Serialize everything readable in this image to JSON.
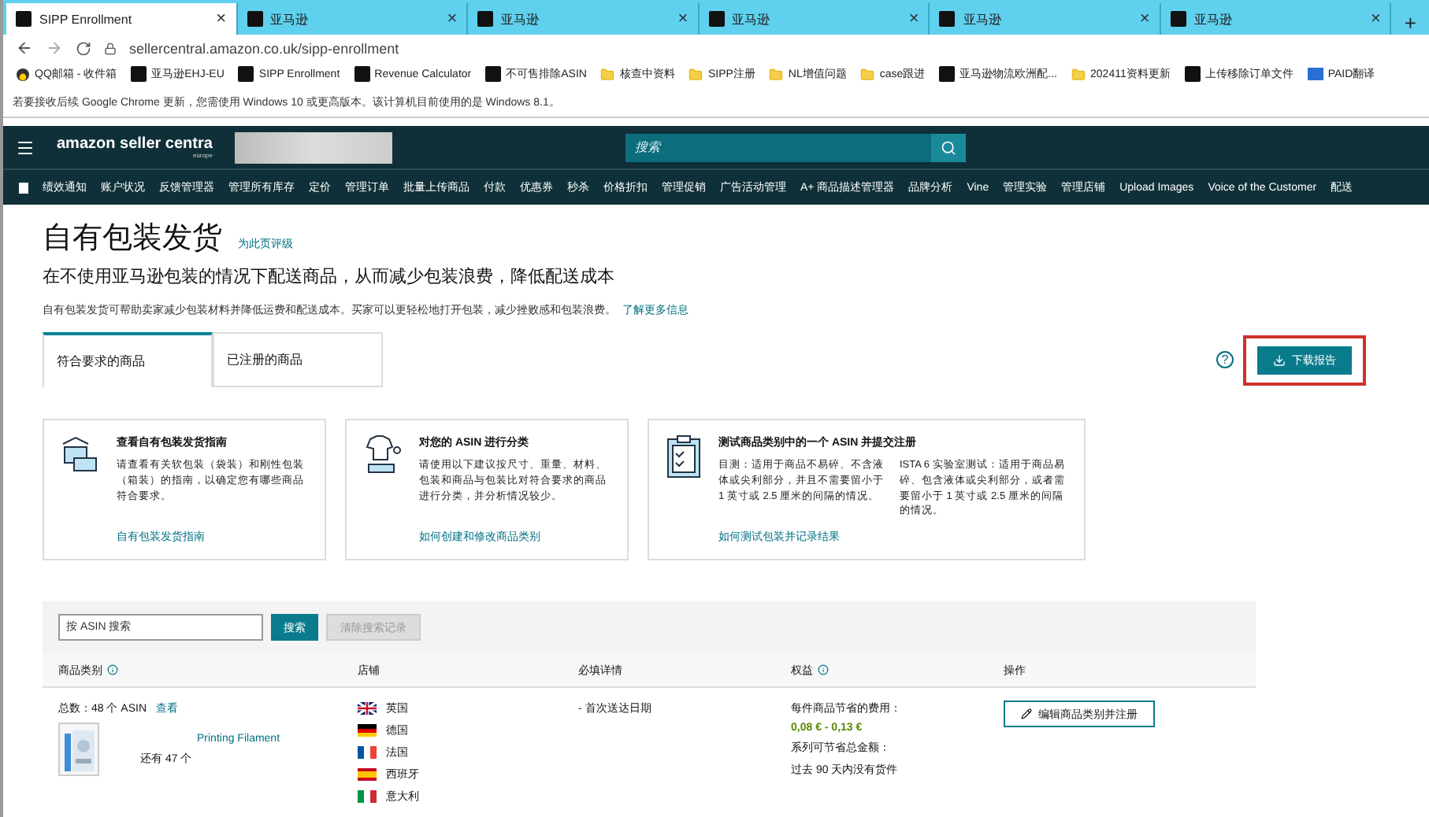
{
  "browser": {
    "tabs": [
      {
        "title": "SIPP Enrollment",
        "selected": true
      },
      {
        "title": "亚马逊",
        "selected": false
      },
      {
        "title": "亚马逊",
        "selected": false
      },
      {
        "title": "亚马逊",
        "selected": false
      },
      {
        "title": "亚马逊",
        "selected": false
      },
      {
        "title": "亚马逊",
        "selected": false
      }
    ],
    "new_tab": "+",
    "tab_close": "×",
    "url": "sellercentral.amazon.co.uk/sipp-enrollment",
    "bookmarks": [
      {
        "label": "QQ邮箱 - 收件箱",
        "kind": "qq"
      },
      {
        "label": "亚马逊EHJ-EU",
        "kind": "site"
      },
      {
        "label": "SIPP Enrollment",
        "kind": "site"
      },
      {
        "label": "Revenue Calculator",
        "kind": "site"
      },
      {
        "label": "不可售排除ASIN",
        "kind": "site"
      },
      {
        "label": "核查中资料",
        "kind": "folder"
      },
      {
        "label": "SIPP注册",
        "kind": "folder"
      },
      {
        "label": "NL增值问题",
        "kind": "folder"
      },
      {
        "label": "case跟进",
        "kind": "folder"
      },
      {
        "label": "亚马逊物流欧洲配...",
        "kind": "site"
      },
      {
        "label": "202411资料更新",
        "kind": "folder"
      },
      {
        "label": "上传移除订单文件",
        "kind": "site"
      },
      {
        "label": "PAID翻译",
        "kind": "xm"
      }
    ],
    "notice": "若要接收后续 Google Chrome 更新，您需使用 Windows 10 或更高版本。该计算机目前使用的是 Windows 8.1。"
  },
  "header": {
    "logo": "amazon seller centra",
    "logo_region": "europe",
    "search_placeholder": "搜索"
  },
  "nav": [
    "绩效通知",
    "账户状况",
    "反馈管理器",
    "管理所有库存",
    "定价",
    "管理订单",
    "批量上传商品",
    "付款",
    "优惠券",
    "秒杀",
    "价格折扣",
    "管理促销",
    "广告活动管理",
    "A+ 商品描述管理器",
    "品牌分析",
    "Vine",
    "管理实验",
    "管理店铺",
    "Upload Images",
    "Voice of the Customer",
    "配送"
  ],
  "page": {
    "title": "自有包装发货",
    "rate_link": "为此页评级",
    "subtitle": "在不使用亚马逊包装的情况下配送商品，从而减少包装浪费，降低配送成本",
    "description": "自有包装发货可帮助卖家减少包装材料并降低运费和配送成本。买家可以更轻松地打开包装，减少挫败感和包装浪费。",
    "learn_more": "了解更多信息",
    "tabs": [
      {
        "label": "符合要求的商品",
        "selected": true
      },
      {
        "label": "已注册的商品",
        "selected": false
      }
    ],
    "help": "?",
    "download_button": "下载报告"
  },
  "cards": [
    {
      "kind": "boxes",
      "title": "查看自有包装发货指南",
      "texts": [
        "请查看有关软包装（袋装）和刚性包装（箱装）的指南，以确定您有哪些商品符合要求。"
      ],
      "link": "自有包装发货指南"
    },
    {
      "kind": "shirt",
      "title": "对您的 ASIN 进行分类",
      "texts": [
        "请使用以下建议按尺寸、重量、材料、包装和商品与包装比对符合要求的商品进行分类，并分析情况较少。"
      ],
      "link": "如何创建和修改商品类别"
    },
    {
      "kind": "clipboard",
      "title": "测试商品类别中的一个 ASIN 并提交注册",
      "texts": [
        "目测：适用于商品不易碎、不含液体或尖利部分，并且不需要留小于 1 英寸或 2.5 厘米的间隔的情况。",
        "ISTA 6 实验室测试：适用于商品易碎、包含液体或尖利部分，或者需要留小于 1 英寸或 2.5 厘米的间隔的情况。"
      ],
      "link": "如何测试包装并记录结果"
    }
  ],
  "search": {
    "placeholder": "按 ASIN 搜索",
    "button": "搜索",
    "clear_button": "清除搜索记录",
    "clear_disabled": true
  },
  "table": {
    "columns": [
      {
        "label": "商品类别",
        "info": true
      },
      {
        "label": "店铺",
        "info": false
      },
      {
        "label": "必填详情",
        "info": false
      },
      {
        "label": "权益",
        "info": true
      },
      {
        "label": "操作",
        "info": false
      }
    ],
    "rows": [
      {
        "total": "总数：48 个 ASIN",
        "view_link": "查看",
        "product": "Printing Filament",
        "more": "还有 47 个",
        "stores": [
          {
            "name": "英国",
            "kind": "uk"
          },
          {
            "name": "德国",
            "kind": "de"
          },
          {
            "name": "法国",
            "kind": "fr"
          },
          {
            "name": "西班牙",
            "kind": "es"
          },
          {
            "name": "意大利",
            "kind": "it"
          }
        ],
        "details": "- 首次送达日期",
        "savings_label": "每件商品节省的费用：",
        "savings": "0,08 € - 0,13 €",
        "total_label": "系列可节省总金额：",
        "total_value": "过去 90 天内没有货件",
        "action": "编辑商品类别并注册"
      }
    ]
  }
}
